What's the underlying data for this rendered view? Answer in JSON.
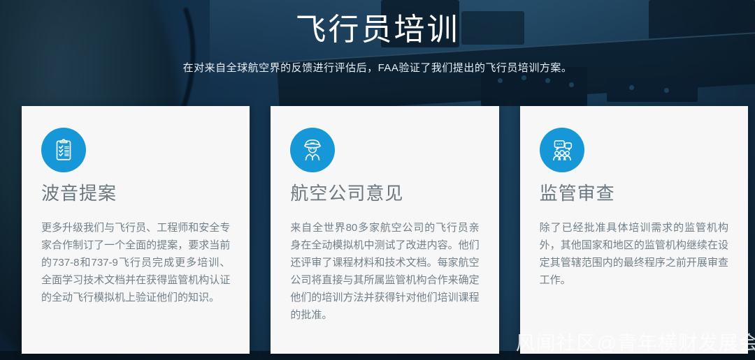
{
  "page": {
    "title": "飞行员培训",
    "subtitle": "在对来自全球航空界的反馈进行评估后，FAA验证了我们提出的飞行员培训方案。"
  },
  "cards": [
    {
      "icon": "clipboard-checklist-icon",
      "title": "波音提案",
      "body": "更多升级我们与飞行员、工程师和安全专家合作制订了一个全面的提案，要求当前的737-8和737-9飞行员完成更多培训、全面学习技术文档并在获得监管机构认证的全动飞行模拟机上验证他们的知识。"
    },
    {
      "icon": "pilot-icon",
      "title": "航空公司意见",
      "body": "来自全世界80多家航空公司的飞行员亲身在全动模拟机中测试了改进内容。他们还评审了课程材料和技术文档。每家航空公司将直接与其所属监管机构合作来确定他们的培训方法并获得针对他们培训课程的批准。"
    },
    {
      "icon": "group-discussion-icon",
      "title": "监管审查",
      "body": "除了已经批准具体培训需求的监管机构外，其他国家和地区的监管机构继续在设定其管辖范围内的最终程序之前开展审查工作。"
    }
  ],
  "watermark": "风闻社区@青年横财发展会",
  "colors": {
    "accent_blue": "#1697d8",
    "background_navy": "#13314a",
    "card_background": "#f7f7f7",
    "heading_gray": "#6b7880",
    "body_gray": "#72808a"
  }
}
